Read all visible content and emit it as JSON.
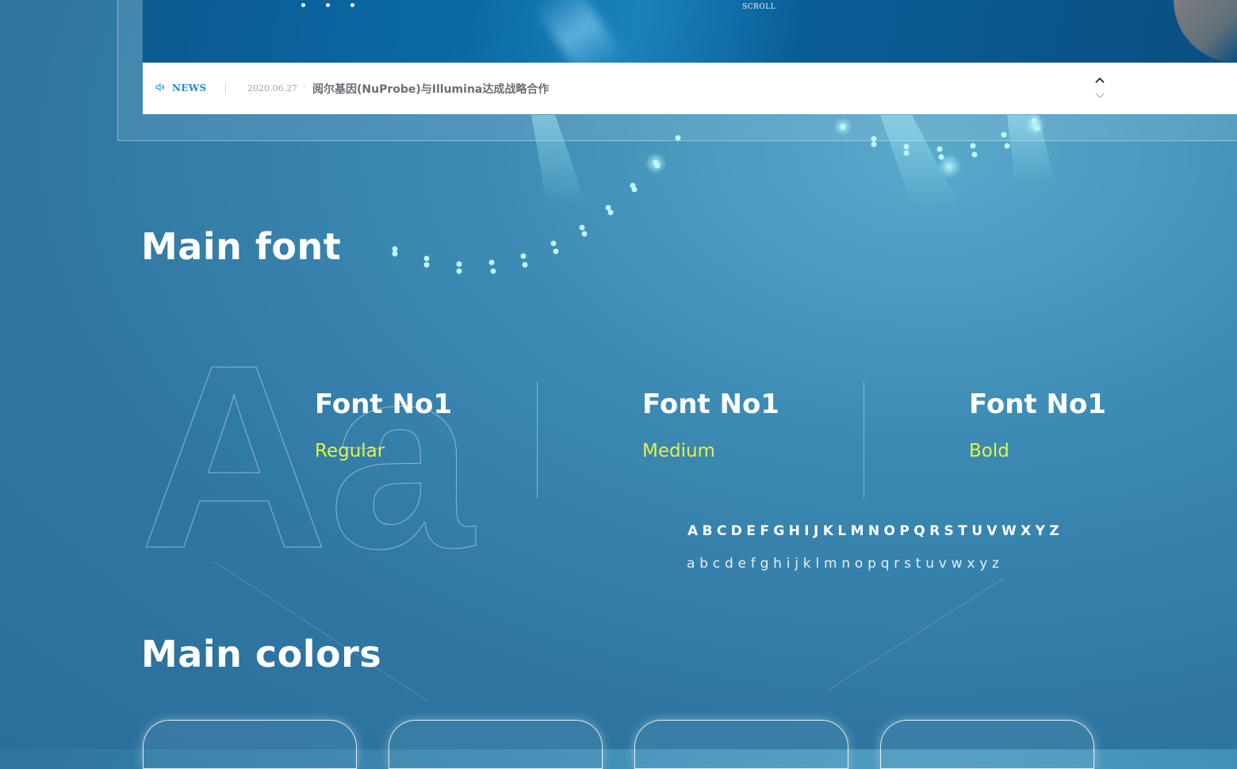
{
  "hero": {
    "scroll_label": "SCROLL",
    "pager_dots": 3
  },
  "news": {
    "label": "NEWS",
    "date": "2020.06.27",
    "separator": "·",
    "title": "阅尔基因(NuProbe)与Illumina达成战略合作",
    "icons": {
      "speaker": "speaker-icon",
      "up": "chevron-up-icon",
      "down": "chevron-down-icon"
    }
  },
  "main_font": {
    "title": "Main font",
    "sample_glyphs": "Aa",
    "fonts": [
      {
        "name": "Font No1",
        "weight": "Regular"
      },
      {
        "name": "Font No1",
        "weight": "Medium"
      },
      {
        "name": "Font No1",
        "weight": "Bold"
      }
    ],
    "uppercase": "ABCDEFGHIJKLMNOPQRSTUVWXYZ",
    "lowercase": "abcdefghijklmnopqrstuvwxyz"
  },
  "main_colors": {
    "title": "Main colors",
    "cards": 4
  },
  "colors": {
    "background": "#2e76a1",
    "accent_blue": "#1f8fd0",
    "weight_yellow": "#e4f248",
    "news_title_gray": "#6a6f75"
  }
}
